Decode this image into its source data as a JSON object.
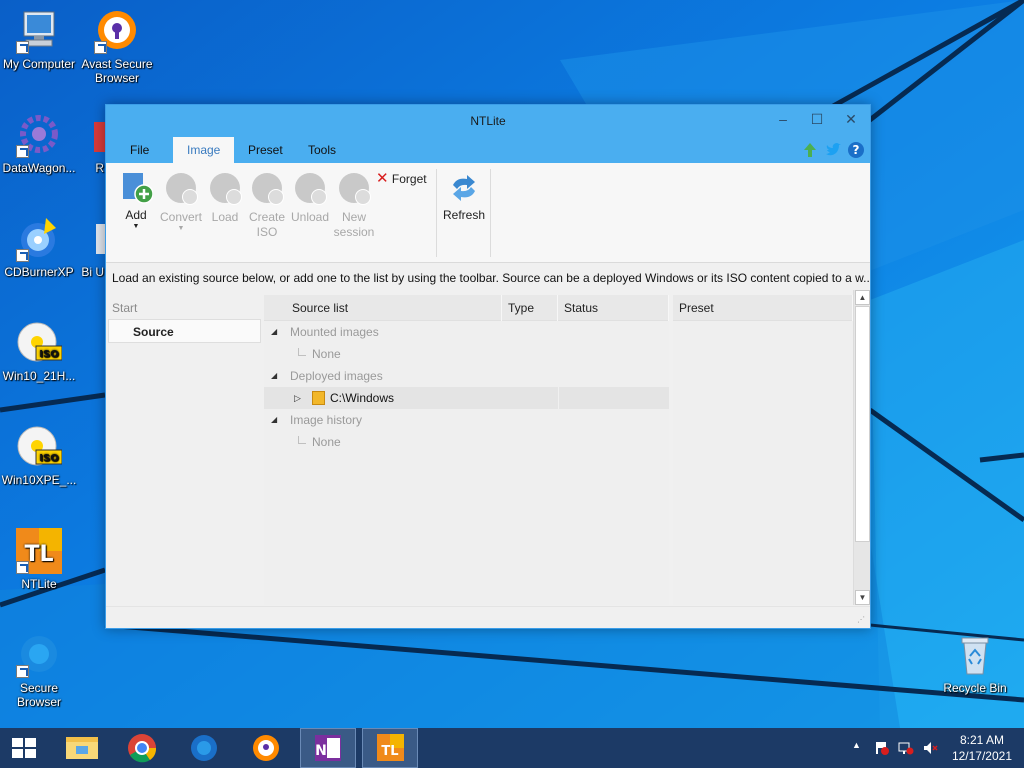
{
  "desktop": {
    "icons": [
      {
        "label": "My Computer",
        "icon": "computer-icon"
      },
      {
        "label": "Avast Secure Browser",
        "icon": "avast-browser-icon"
      },
      {
        "label": "DataWagon...",
        "icon": "datawagon-icon"
      },
      {
        "label": "R",
        "icon": "partial-icon"
      },
      {
        "label": "CDBurnerXP",
        "icon": "cdburnerxp-icon"
      },
      {
        "label": "Bi U",
        "icon": "partial-icon"
      },
      {
        "label": "Win10_21H...",
        "icon": "iso-icon"
      },
      {
        "label": "Win10XPE_...",
        "icon": "iso-icon"
      },
      {
        "label": "NTLite",
        "icon": "ntlite-icon"
      },
      {
        "label": "Secure Browser",
        "icon": "secure-browser-icon"
      },
      {
        "label": "Recycle Bin",
        "icon": "recycle-bin-icon"
      }
    ]
  },
  "window": {
    "title": "NTLite",
    "controls": {
      "minimize": "–",
      "maximize": "☐",
      "close": "✕"
    },
    "menu": [
      {
        "label": "File"
      },
      {
        "label": "Image",
        "active": true
      },
      {
        "label": "Preset"
      },
      {
        "label": "Tools"
      }
    ],
    "ribbon": {
      "add": "Add",
      "convert": "Convert",
      "load": "Load",
      "create_iso_1": "Create",
      "create_iso_2": "ISO",
      "unload": "Unload",
      "new_session_1": "New",
      "new_session_2": "session",
      "forget": "Forget",
      "refresh": "Refresh"
    },
    "info_text": "Load an existing source below, or add one to the list by using the toolbar. Source can be a deployed Windows or its ISO content copied to a w...",
    "left_panel": {
      "start": "Start",
      "source": "Source"
    },
    "columns": {
      "source_list": "Source list",
      "type": "Type",
      "status": "Status",
      "preset": "Preset"
    },
    "tree": {
      "mounted": "Mounted images",
      "mounted_none": "None",
      "deployed": "Deployed images",
      "deployed_item": "C:\\Windows",
      "history": "Image history",
      "history_none": "None"
    }
  },
  "taskbar": {
    "time": "8:21 AM",
    "date": "12/17/2021"
  },
  "colors": {
    "window_accent": "#4aaef0",
    "taskbar": "#1c3a66",
    "desktop": "#0a6fd6"
  }
}
